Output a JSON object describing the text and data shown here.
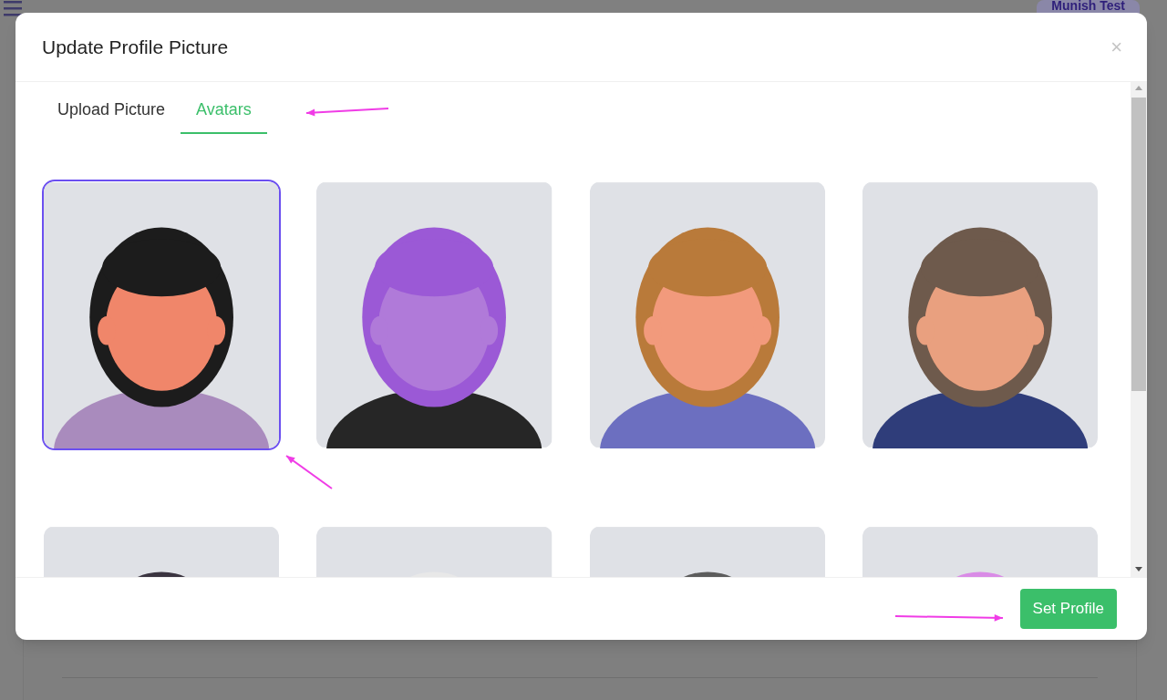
{
  "background": {
    "user_chip": "Munish Test"
  },
  "dialog": {
    "title": "Update Profile Picture",
    "close": "×",
    "tabs": [
      {
        "label": "Upload Picture",
        "selected": false
      },
      {
        "label": "Avatars",
        "selected": true
      }
    ],
    "avatars": [
      {
        "kind": "picture",
        "selected": true
      },
      {
        "kind": "picture",
        "selected": false
      },
      {
        "kind": "picture",
        "selected": false
      },
      {
        "kind": "picture",
        "selected": false
      },
      {
        "kind": "picture",
        "selected": false
      },
      {
        "kind": "picture",
        "selected": false
      },
      {
        "kind": "picture",
        "selected": false
      },
      {
        "kind": "picture",
        "selected": false
      }
    ],
    "button": "Set Profile"
  }
}
